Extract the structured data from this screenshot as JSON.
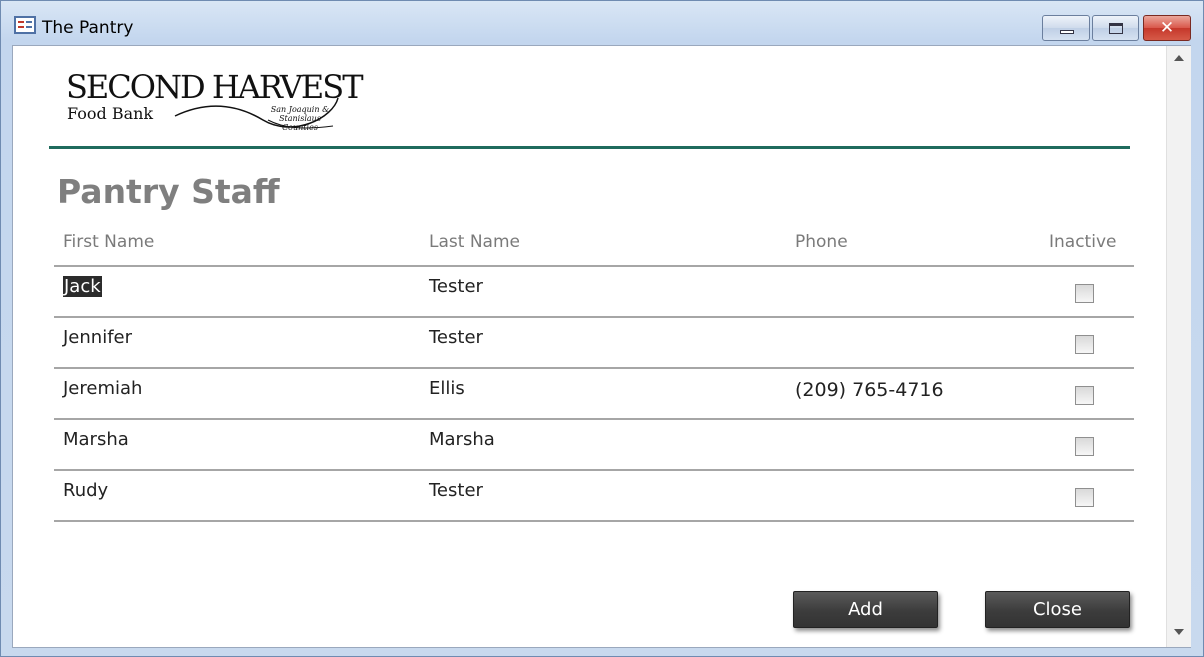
{
  "window": {
    "title": "The Pantry",
    "controls": {
      "minimize": "minimize",
      "maximize": "maximize",
      "close": "✕"
    }
  },
  "logo": {
    "main": "SECOND HARVEST",
    "sub": "Food Bank",
    "region": "San Joaquin & Stanislaus Counties"
  },
  "page": {
    "heading": "Pantry Staff"
  },
  "columns": {
    "first_name": "First Name",
    "last_name": "Last Name",
    "phone": "Phone",
    "inactive": "Inactive"
  },
  "rows": [
    {
      "first_name": "Jack",
      "last_name": "Tester",
      "phone": "",
      "inactive": false,
      "selected": true
    },
    {
      "first_name": "Jennifer",
      "last_name": "Tester",
      "phone": "",
      "inactive": false
    },
    {
      "first_name": "Jeremiah",
      "last_name": "Ellis",
      "phone": "(209) 765-4716",
      "inactive": false
    },
    {
      "first_name": "Marsha",
      "last_name": "Marsha",
      "phone": "",
      "inactive": false
    },
    {
      "first_name": "Rudy",
      "last_name": "Tester",
      "phone": "",
      "inactive": false
    }
  ],
  "buttons": {
    "add": "Add",
    "close": "Close"
  },
  "colors": {
    "accent_rule": "#1f6b5d",
    "heading": "#7f7f7f",
    "button": "#3c3c3c"
  }
}
